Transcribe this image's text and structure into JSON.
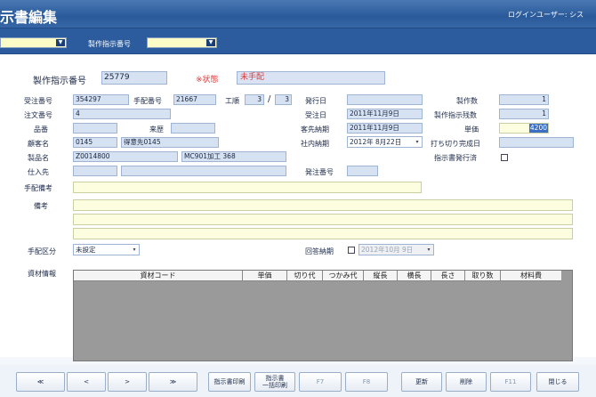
{
  "header": {
    "title": "示書編集",
    "user_label": "ログインユーザー:  シス"
  },
  "toolbar": {
    "combo1_value": "",
    "order_no_label": "製作指示番号",
    "combo2_value": ""
  },
  "main": {
    "order_no_label": "製作指示番号",
    "order_no_value": "25779",
    "status_label": "※状態",
    "status_value": "未手配",
    "jyuchu_label": "受注番号",
    "jyuchu_value": "354297",
    "tehai_label": "手配番号",
    "tehai_value": "21667",
    "koujun_label": "工順",
    "koujun_value1": "3",
    "koujun_sep": "/",
    "koujun_value2": "3",
    "hakko_label": "発行日",
    "hakko_value": "",
    "seisaku_su_label": "製作数",
    "seisaku_su_value": "1",
    "chumon_label": "注文番号",
    "chumon_value": "4",
    "jyuchubi_label": "受注日",
    "jyuchubi_value": "2011年11月9日",
    "shiji_zan_label": "製作指示残数",
    "shiji_zan_value": "1",
    "hinban_label": "品番",
    "hinban_value": "",
    "raireki_label": "来歴",
    "raireki_value": "",
    "kyaku_nouki_label": "客先納期",
    "kyaku_nouki_value": "2011年11月9日",
    "tanka_label": "単価",
    "tanka_value": "4200",
    "kokyaku_label": "顧客名",
    "kokyaku_code": "0145",
    "kokyaku_name": "得意先0145",
    "shanai_label": "社内納期",
    "shanai_value": "2012年  8月22日",
    "uchikiri_label": "打ち切り完成日",
    "uchikiri_value": "",
    "seihin_label": "製品名",
    "seihin_code": "Z0014800",
    "seihin_name": "MC901加工    368",
    "hakko_zumi_label": "指示書発行済",
    "shiire_label": "仕入先",
    "shiire_code": "",
    "shiire_name": "",
    "hacchu_label": "発注番号",
    "hacchu_value": "",
    "tehai_biko_label": "手配備考",
    "tehai_biko_value": "",
    "biko_label": "備考",
    "tehai_kubun_label": "手配区分",
    "tehai_kubun_value": "未設定",
    "kaitou_label": "回答納期",
    "kaitou_value": "2012年10月  9日"
  },
  "grid": {
    "label": "資材情報",
    "columns": [
      "資材コード",
      "単価",
      "切り代",
      "つかみ代",
      "縦長",
      "横長",
      "長さ",
      "取り数",
      "材料費"
    ]
  },
  "footer": {
    "buttons": [
      "≪",
      "<",
      ">",
      "≫",
      "指示書印刷",
      "指示書\n一括印刷",
      "F7",
      "F8",
      "更新",
      "削除",
      "F11",
      "閉じる"
    ]
  }
}
